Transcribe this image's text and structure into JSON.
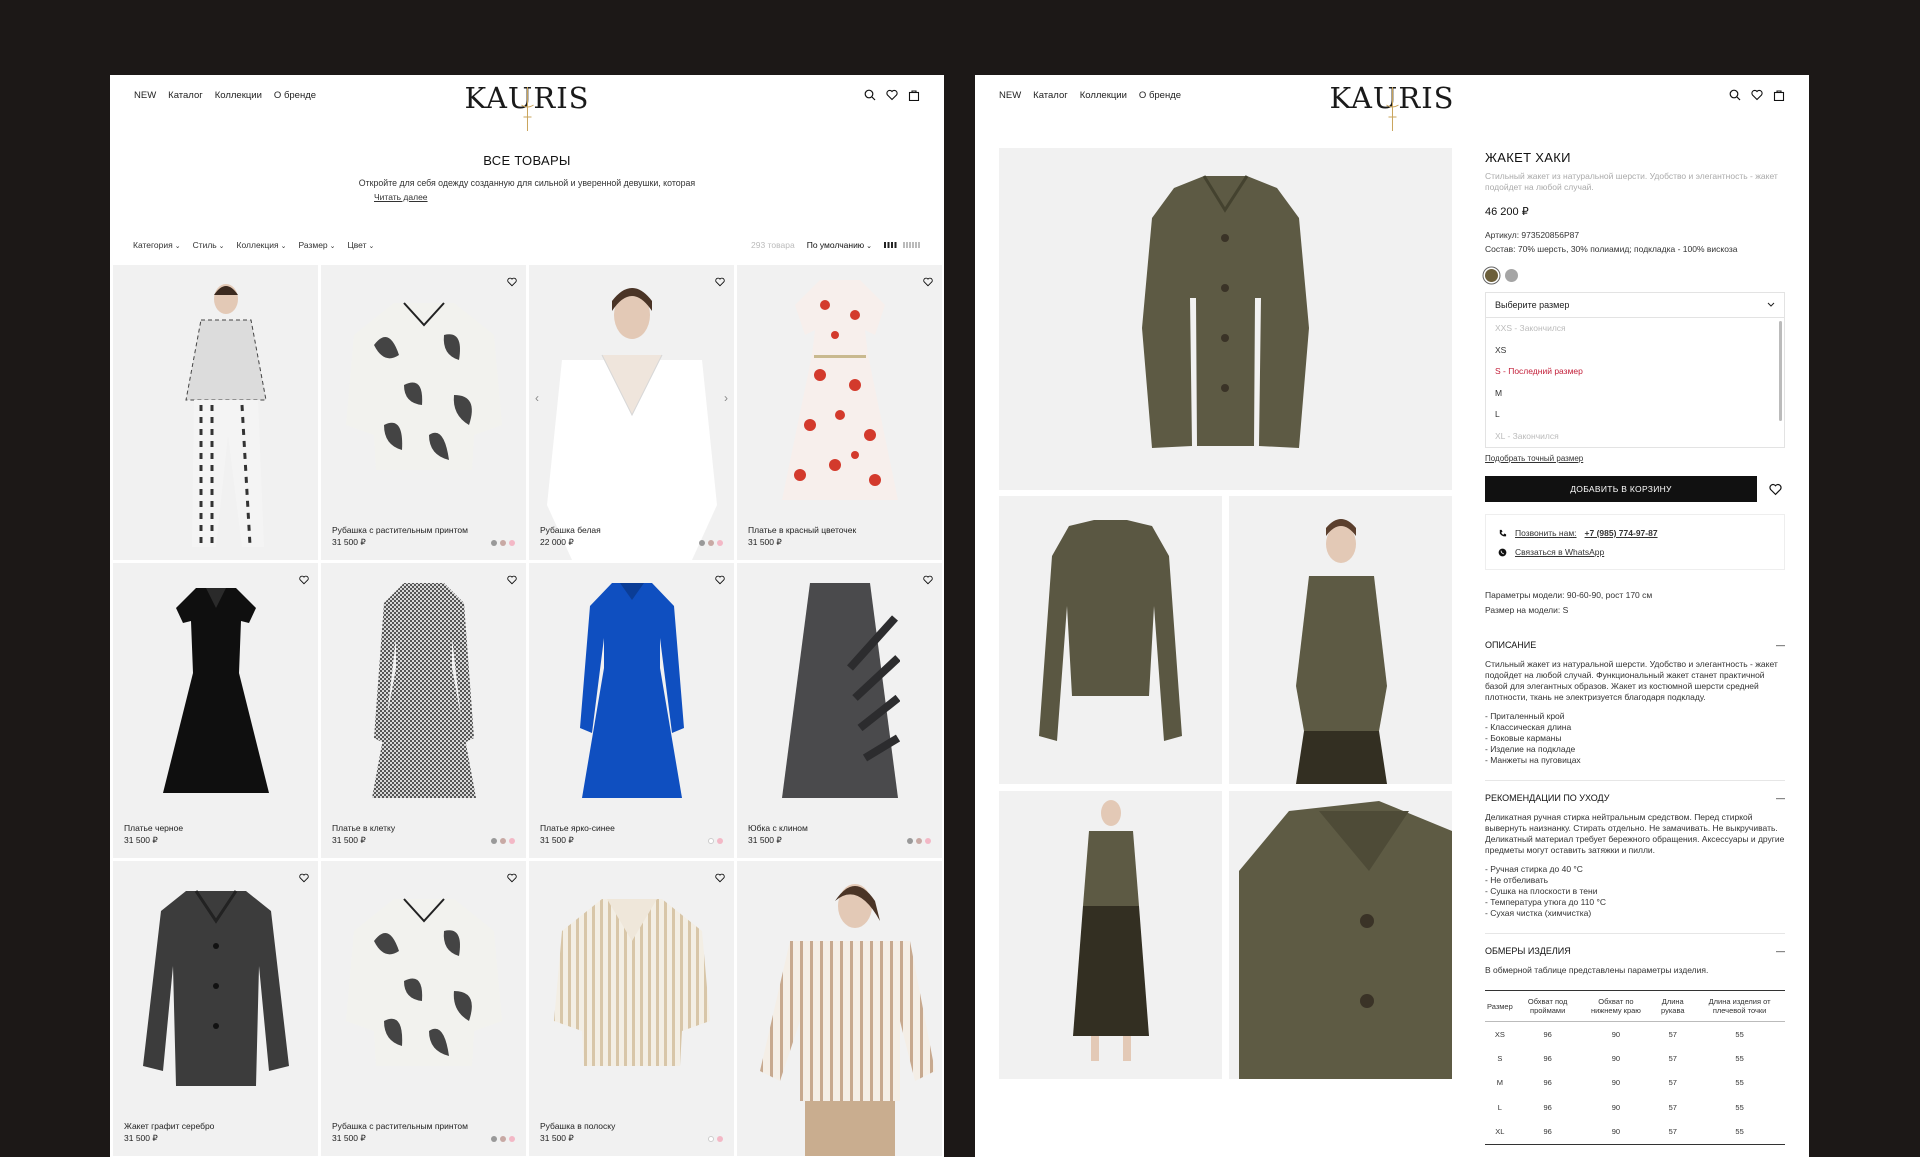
{
  "brand": "KAURIS",
  "nav": [
    "NEW",
    "Каталог",
    "Коллекции",
    "О бренде"
  ],
  "catalog": {
    "title": "ВСЕ ТОВАРЫ",
    "description": "Откройте для себя одежду созданную для сильной и уверенной девушки, которая",
    "read_more": "Читать далее",
    "filters": [
      "Категория",
      "Стиль",
      "Коллекция",
      "Размер",
      "Цвет"
    ],
    "count": "293 товара",
    "sort": "По умолчанию",
    "products": [
      {
        "name": "",
        "price": "",
        "kind": "model-print"
      },
      {
        "name": "Рубашка с растительным принтом",
        "price": "31 500 ₽",
        "kind": "shirt-print",
        "swatches": [
          "#999999",
          "#c8a9a4",
          "#f3b8c6"
        ]
      },
      {
        "name": "Рубашка белая",
        "price": "22 000 ₽",
        "kind": "model-white",
        "swatches": [
          "#999999",
          "#c8a9a4",
          "#f3b8c6"
        ]
      },
      {
        "name": "Платье в красный цветочек",
        "price": "31 500 ₽",
        "kind": "dress-floral"
      },
      {
        "name": "Платье черное",
        "price": "31 500 ₽",
        "kind": "dress-black"
      },
      {
        "name": "Платье в клетку",
        "price": "31 500 ₽",
        "kind": "dress-check",
        "swatches": [
          "#999999",
          "#c8a9a4",
          "#f3b8c6"
        ]
      },
      {
        "name": "Платье ярко-синее",
        "price": "31 500 ₽",
        "kind": "dress-blue",
        "swatches": [
          "#ffffff",
          "#f3b8c6"
        ]
      },
      {
        "name": "Юбка с клином",
        "price": "31 500 ₽",
        "kind": "skirt-grey",
        "swatches": [
          "#999999",
          "#c8a9a4",
          "#f3b8c6"
        ]
      },
      {
        "name": "Жакет графит серебро",
        "price": "31 500 ₽",
        "kind": "jacket-grey"
      },
      {
        "name": "Рубашка с растительным принтом",
        "price": "31 500 ₽",
        "kind": "shirt-print",
        "swatches": [
          "#999999",
          "#c8a9a4",
          "#f3b8c6"
        ]
      },
      {
        "name": "Рубашка в полоску",
        "price": "31 500 ₽",
        "kind": "shirt-stripe",
        "swatches": [
          "#ffffff",
          "#f3b8c6"
        ]
      },
      {
        "name": "",
        "price": "",
        "kind": "model-stripe"
      }
    ]
  },
  "product": {
    "title": "ЖАКЕТ ХАКИ",
    "subtitle": "Стильный жакет из натуральной шерсти. Удобство и элегантность - жакет подойдет на любой случай.",
    "price": "46 200 ₽",
    "article": "Артикул: 973520856P87",
    "composition": "Состав: 70% шерсть, 30% полиамид; подкладка - 100% вискоза",
    "colors": [
      "#6b5e3a",
      "#a5a5a5"
    ],
    "size_placeholder": "Выберите размер",
    "sizes": [
      {
        "label": "XXS - Закончился",
        "state": "out"
      },
      {
        "label": "XS",
        "state": "ok"
      },
      {
        "label": "S - Последний размер",
        "state": "last"
      },
      {
        "label": "M",
        "state": "ok"
      },
      {
        "label": "L",
        "state": "ok"
      },
      {
        "label": "XL - Закончился",
        "state": "out"
      }
    ],
    "fit_link": "Подобрать точный размер",
    "add_to_cart": "ДОБАВИТЬ В КОРЗИНУ",
    "call_label": "Позвонить нам:",
    "call_phone": "+7 (985) 774-97-87",
    "whatsapp": "Связаться в WhatsApp",
    "model_params": "Параметры модели: 90-60-90, рост 170 см",
    "model_size": "Размер на модели: S",
    "description": {
      "title": "ОПИСАНИЕ",
      "text": "Стильный жакет из натуральной шерсти. Удобство и элегантность - жакет подойдет на любой случай. Функциональный жакет станет практичной базой для элегантных образов. Жакет из костюмной шерсти средней плотности, ткань не электризуется благодаря подкладу.",
      "bullets": [
        "- Приталенный крой",
        "- Классическая длина",
        "- Боковые карманы",
        "- Изделие на подкладе",
        "- Манжеты на пуговицах"
      ]
    },
    "care": {
      "title": "РЕКОМЕНДАЦИИ ПО УХОДУ",
      "text": "Деликатная ручная стирка нейтральным средством. Перед стиркой вывернуть наизнанку. Стирать отдельно. Не замачивать. Не выкручивать. Деликатный материал требует бережного обращения. Аксессуары и другие предметы могут оставить затяжки и пилли.",
      "bullets": [
        "- Ручная стирка до 40 °С",
        "- Не отбеливать",
        "- Сушка на плоскости в тени",
        "- Температура утюга до 110 °С",
        "- Сухая чистка (химчистка)"
      ]
    },
    "measurements": {
      "title": "ОБМЕРЫ ИЗДЕЛИЯ",
      "text": "В обмерной таблице представлены параметры изделия.",
      "headers": [
        "Размер",
        "Обхват под проймами",
        "Обхват по нижнему краю",
        "Длина рукава",
        "Длина изделия от плечевой точки"
      ],
      "rows": [
        [
          "XS",
          "96",
          "90",
          "57",
          "55"
        ],
        [
          "S",
          "96",
          "90",
          "57",
          "55"
        ],
        [
          "M",
          "96",
          "90",
          "57",
          "55"
        ],
        [
          "L",
          "96",
          "90",
          "57",
          "55"
        ],
        [
          "XL",
          "96",
          "90",
          "57",
          "55"
        ]
      ]
    }
  }
}
